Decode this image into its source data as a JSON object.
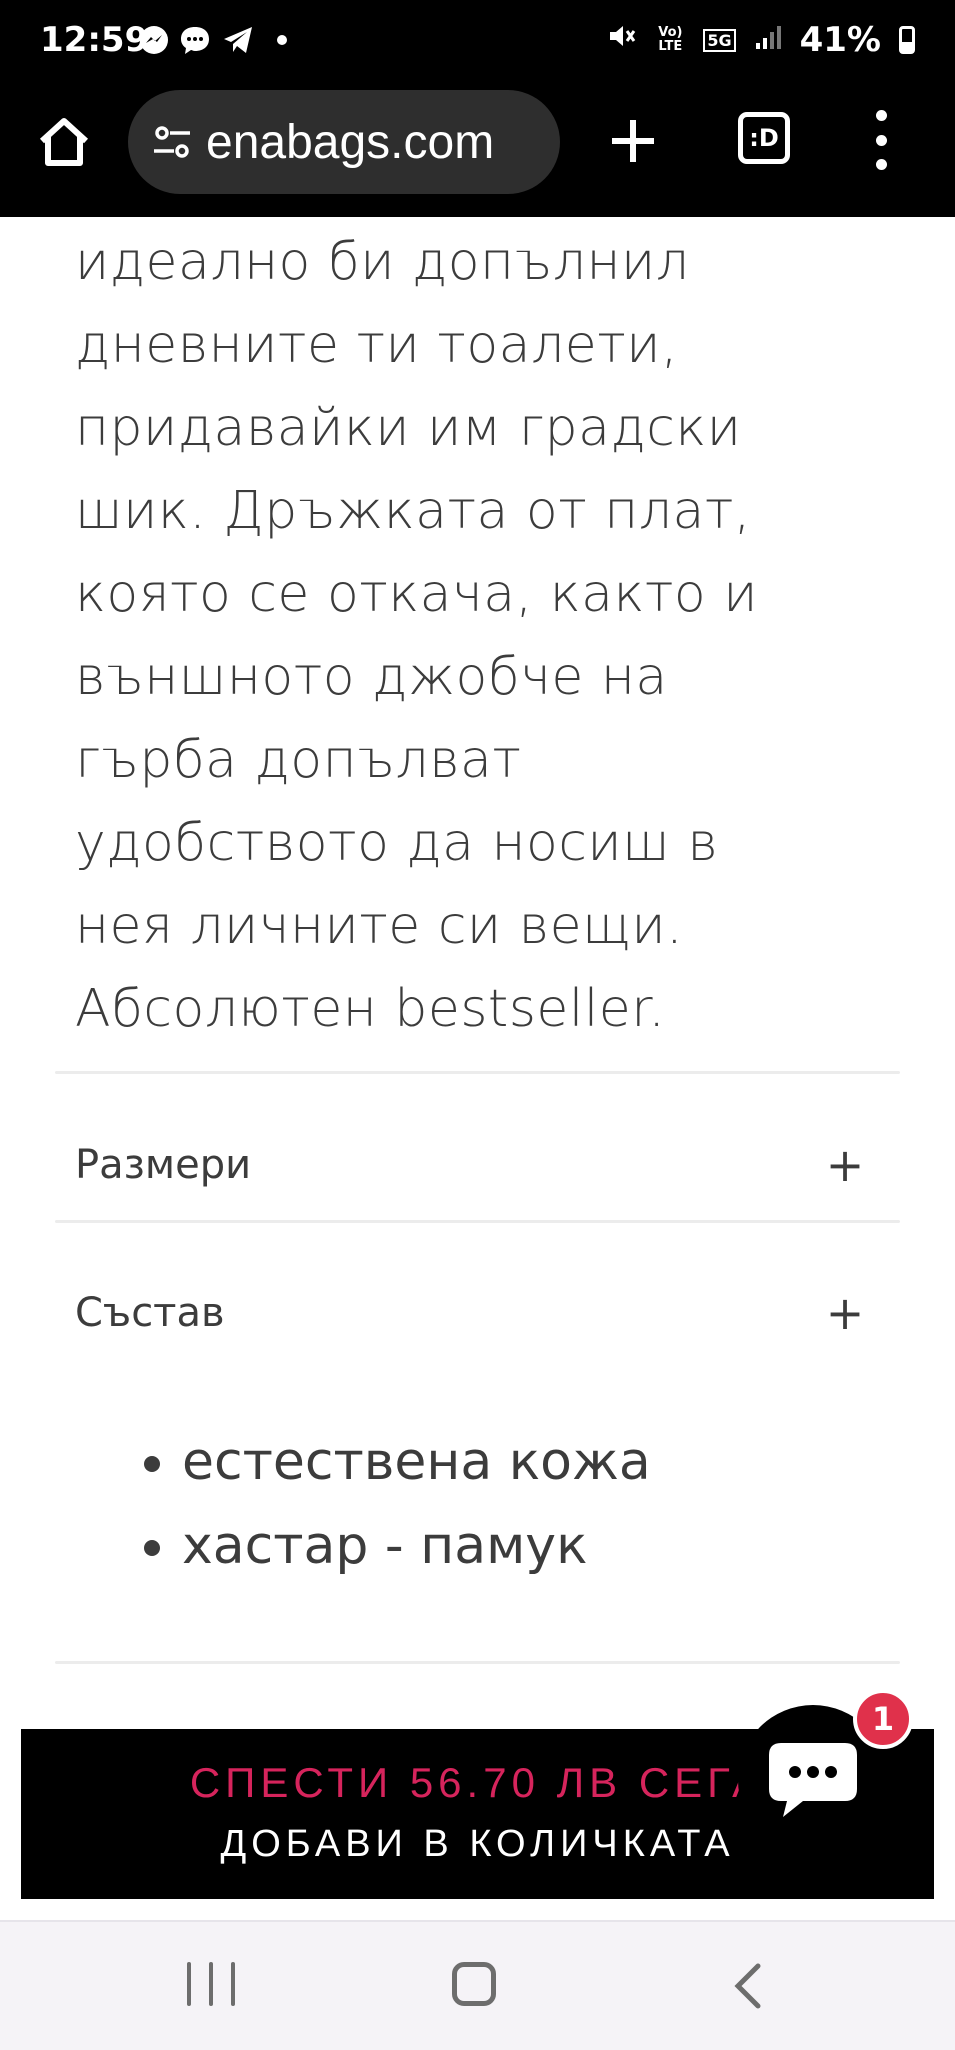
{
  "status_bar": {
    "time": "12:59",
    "battery": "41%",
    "network": "5G",
    "volte": "Vo) LTE",
    "icons": [
      "messenger-icon",
      "chat-icon",
      "telegram-icon",
      "dot-icon",
      "mute-icon",
      "signal-icon",
      "battery-icon"
    ]
  },
  "browser": {
    "url": "enabags.com",
    "tabs_label": ":D",
    "icons": [
      "home-icon",
      "site-settings-icon",
      "new-tab-icon",
      "tabs-icon",
      "menu-icon"
    ]
  },
  "product": {
    "description_lines": [
      "идеално би допълнил",
      "дневните ти тоалети,",
      "придавайки им градски",
      "шик. Дръжката от плат,",
      "която се откача, както и",
      "външното джобче на",
      "гърба допълват",
      "удобството да носиш в",
      "нея личните си вещи.",
      "Абсолютен bestseller."
    ],
    "accordion": {
      "sizes_label": "Размери",
      "composition_label": "Състав",
      "toggle_symbol": "+"
    },
    "composition_items": [
      "естествена кожа",
      "хастар - памук"
    ]
  },
  "cart_bar": {
    "save_text": "СПЕСТИ 56.70 ЛВ СЕГА",
    "add_text": "ДОБАВИ В КОЛИЧКАТА"
  },
  "chat": {
    "badge_count": "1"
  },
  "colors": {
    "accent": "#d6245c",
    "badge": "#e0314b",
    "text": "#3c3c3c"
  }
}
